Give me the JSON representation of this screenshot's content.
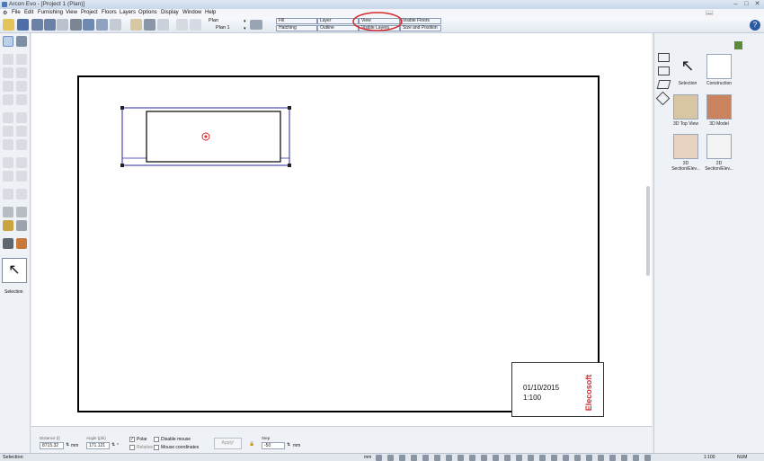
{
  "window": {
    "title": "Arcon Evo - [Project 1 (Plan)]",
    "min": "–",
    "max": "□",
    "close": "✕"
  },
  "menu": [
    "File",
    "Edit",
    "Furnishing",
    "View",
    "Project",
    "Floors",
    "Layers",
    "Options",
    "Display",
    "Window",
    "Help"
  ],
  "toolbar": {
    "plan_dropdown": "Plan",
    "plan1_dropdown": "Plan 1",
    "buttons": [
      "Fill",
      "Layer",
      "View",
      "Visible Floors",
      "Hatching",
      "Outline",
      "Visible Layers",
      "Size and Position"
    ]
  },
  "left_panel": {
    "selection_label": "Selection"
  },
  "right_panel": {
    "items": [
      {
        "label": "Selection",
        "icon": "cursor-icon"
      },
      {
        "label": "Construction",
        "icon": "construction-icon"
      },
      {
        "label": "3D Top View",
        "icon": "3d-top-view-icon"
      },
      {
        "label": "3D Model",
        "icon": "3d-model-icon"
      },
      {
        "label": "3D Section/Elev...",
        "icon": "3d-section-icon"
      },
      {
        "label": "2D Section/Elev...",
        "icon": "2d-section-icon"
      }
    ]
  },
  "drawing": {
    "date": "01/10/2015",
    "scale": "1:100",
    "brand": "Elecosoft",
    "brand_color": "#d8282b",
    "highlight_color": "#d8282b",
    "selection_color": "#2a2aa8"
  },
  "bottom": {
    "distance_label": "Distance (l)",
    "distance_value": "8715.32",
    "distance_unit": "mm",
    "angle_label": "Angle (phi)",
    "angle_value": "171.121",
    "angle_unit": "°",
    "polar_label": "Polar",
    "relative_label": "Relative",
    "disable_mouse_label": "Disable mouse",
    "mouse_coords_label": "Mouse coordinates",
    "apply_label": "Apply!",
    "step_label": "Step",
    "step_value": "-50",
    "step_unit": "mm"
  },
  "status": {
    "left": "Selection",
    "unit": "mm",
    "scale": "1:100",
    "num": "NUM"
  }
}
